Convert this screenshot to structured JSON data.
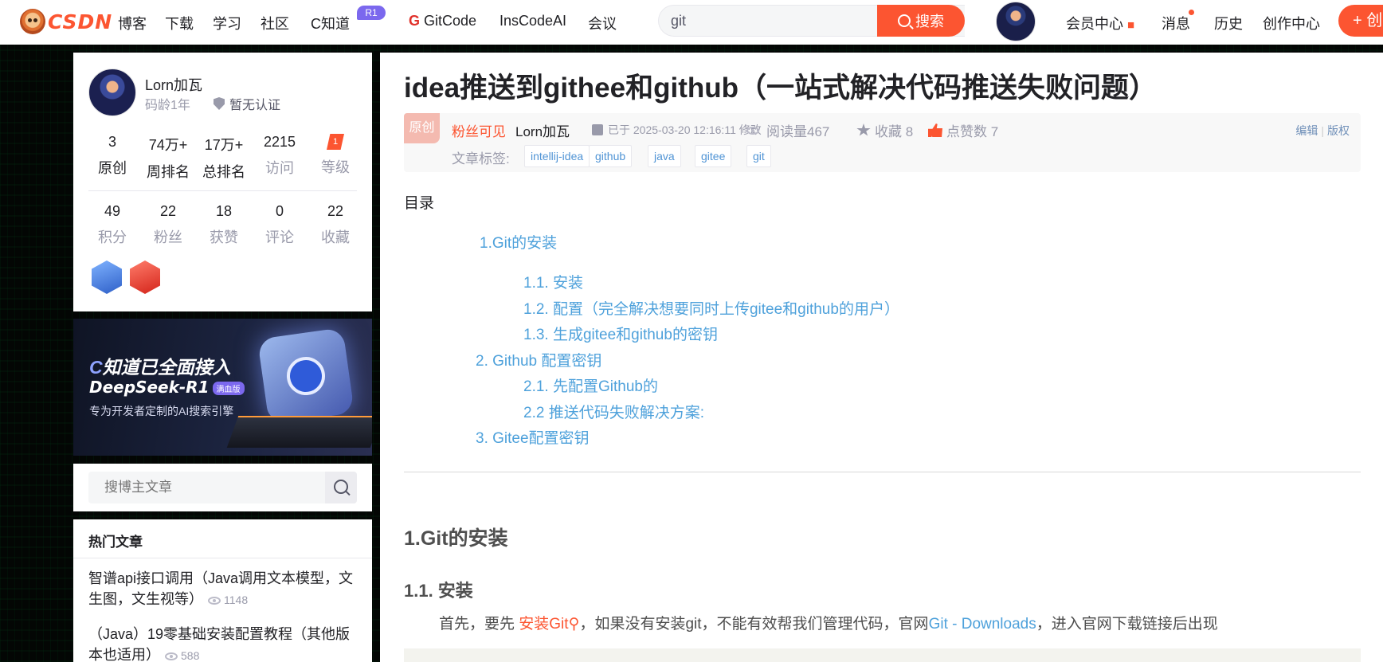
{
  "nav": {
    "logo": "CSDN",
    "links": [
      "博客",
      "下载",
      "学习",
      "社区"
    ],
    "zhidao": "C知道",
    "zhidao_badge": "R1",
    "gitcode": "GitCode",
    "inscode": "InsCodeAI",
    "meeting": "会议",
    "search_value": "git",
    "search_button": "搜索",
    "vip": "会员中心",
    "messages": "消息",
    "history": "历史",
    "creator": "创作中心",
    "create": "+ 创"
  },
  "profile": {
    "name": "Lorn加瓦",
    "code_age": "码龄1年",
    "cert": "暂无认证",
    "stats_row1": [
      {
        "num": "3",
        "label": "原创"
      },
      {
        "num": "74万+",
        "label": "周排名"
      },
      {
        "num": "17万+",
        "label": "总排名"
      },
      {
        "num": "2215",
        "label": "访问"
      },
      {
        "num": "",
        "label": "等级"
      }
    ],
    "stats_row2": [
      {
        "num": "49",
        "label": "积分"
      },
      {
        "num": "22",
        "label": "粉丝"
      },
      {
        "num": "18",
        "label": "获赞"
      },
      {
        "num": "0",
        "label": "评论"
      },
      {
        "num": "22",
        "label": "收藏"
      }
    ]
  },
  "banner": {
    "line1_c": "C",
    "line1": "知道已全面接入",
    "line2": "DeepSeek-R1",
    "tag": "满血版",
    "line3": "专为开发者定制的AI搜索引擎"
  },
  "side_search": {
    "placeholder": "搜博主文章"
  },
  "hot": {
    "title": "热门文章",
    "items": [
      {
        "title": "智谱api接口调用（Java调用文本模型，文生图，文生视等）",
        "views": "1148"
      },
      {
        "title": "（Java）19零基础安装配置教程（其他版本也适用）",
        "views": "588"
      }
    ]
  },
  "article": {
    "title": "idea推送到githee和github（一站式解决代码推送失败问题）",
    "badge": "原创",
    "visibility": "粉丝可见",
    "author": "Lorn加瓦",
    "date": "已于 2025-03-20 12:16:11 修改",
    "reads": "阅读量467",
    "favorites": "收藏 8",
    "likes": "点赞数 7",
    "edit": "编辑",
    "copyright": "版权",
    "tags_label": "文章标签:",
    "tags": [
      "intellij-idea",
      "github",
      "java",
      "gitee",
      "git"
    ],
    "toc_label": "目录",
    "toc": [
      "1.Git的安装",
      "1.1. 安装",
      "1.2. 配置（完全解决想要同时上传gitee和github的用户）",
      "1.3. 生成gitee和github的密钥",
      "2. Github 配置密钥",
      "2.1. 先配置Github的",
      "2.2 推送代码失败解决方案:",
      "3. Gitee配置密钥"
    ],
    "h2": "1.Git的安装",
    "h3": "1.1. 安装",
    "para_pre": "首先，要先 ",
    "para_link1": "安装Git",
    "para_mid": "，如果没有安装git，不能有效帮我们管理代码，官网",
    "para_link2": "Git - Downloads",
    "para_post": "，进入官网下载链接后出现"
  }
}
